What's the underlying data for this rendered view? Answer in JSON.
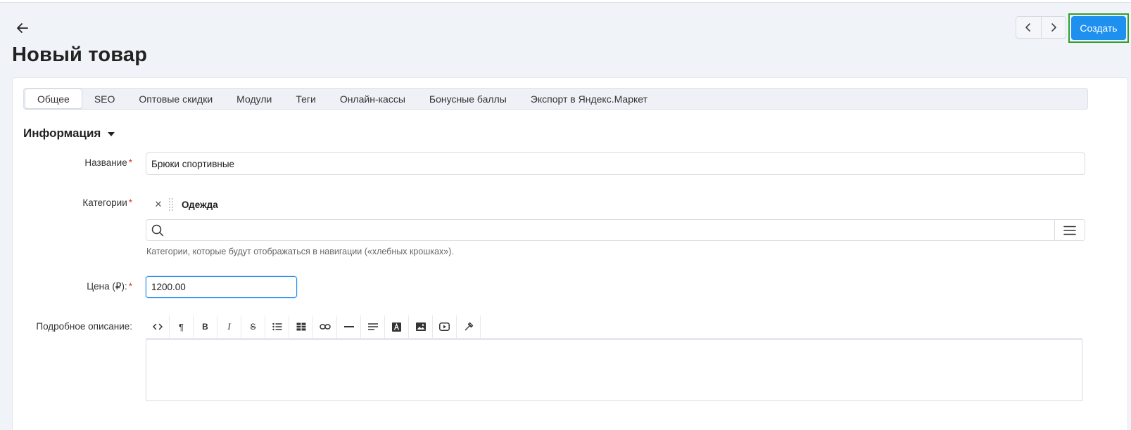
{
  "header": {
    "title": "Новый товар",
    "create_label": "Создать"
  },
  "tabs": [
    {
      "label": "Общее",
      "active": true
    },
    {
      "label": "SEO"
    },
    {
      "label": "Оптовые скидки"
    },
    {
      "label": "Модули"
    },
    {
      "label": "Теги"
    },
    {
      "label": "Онлайн-кассы"
    },
    {
      "label": "Бонусные баллы"
    },
    {
      "label": "Экспорт в Яндекс.Маркет"
    }
  ],
  "section": {
    "title": "Информация"
  },
  "form": {
    "name_label": "Название",
    "name_value": "Брюки спортивные",
    "categories_label": "Категории",
    "category_tag": "Одежда",
    "categories_hint": "Категории, которые будут отображаться в навигации («хлебных крошках»).",
    "price_label": "Цена (₽):",
    "price_value": "1200.00",
    "description_label": "Подробное описание:",
    "required_mark": "*"
  },
  "toolbar_icons": [
    "code-icon",
    "paragraph-icon",
    "bold-icon",
    "italic-icon",
    "strikethrough-icon",
    "unordered-list-icon",
    "table-icon",
    "link-icon",
    "horizontal-rule-icon",
    "align-icon",
    "font-color-icon",
    "image-icon",
    "video-icon",
    "clear-format-icon"
  ],
  "colors": {
    "accent": "#1e90f0",
    "required": "#e23b3b",
    "highlight_frame": "#2fa02f"
  }
}
